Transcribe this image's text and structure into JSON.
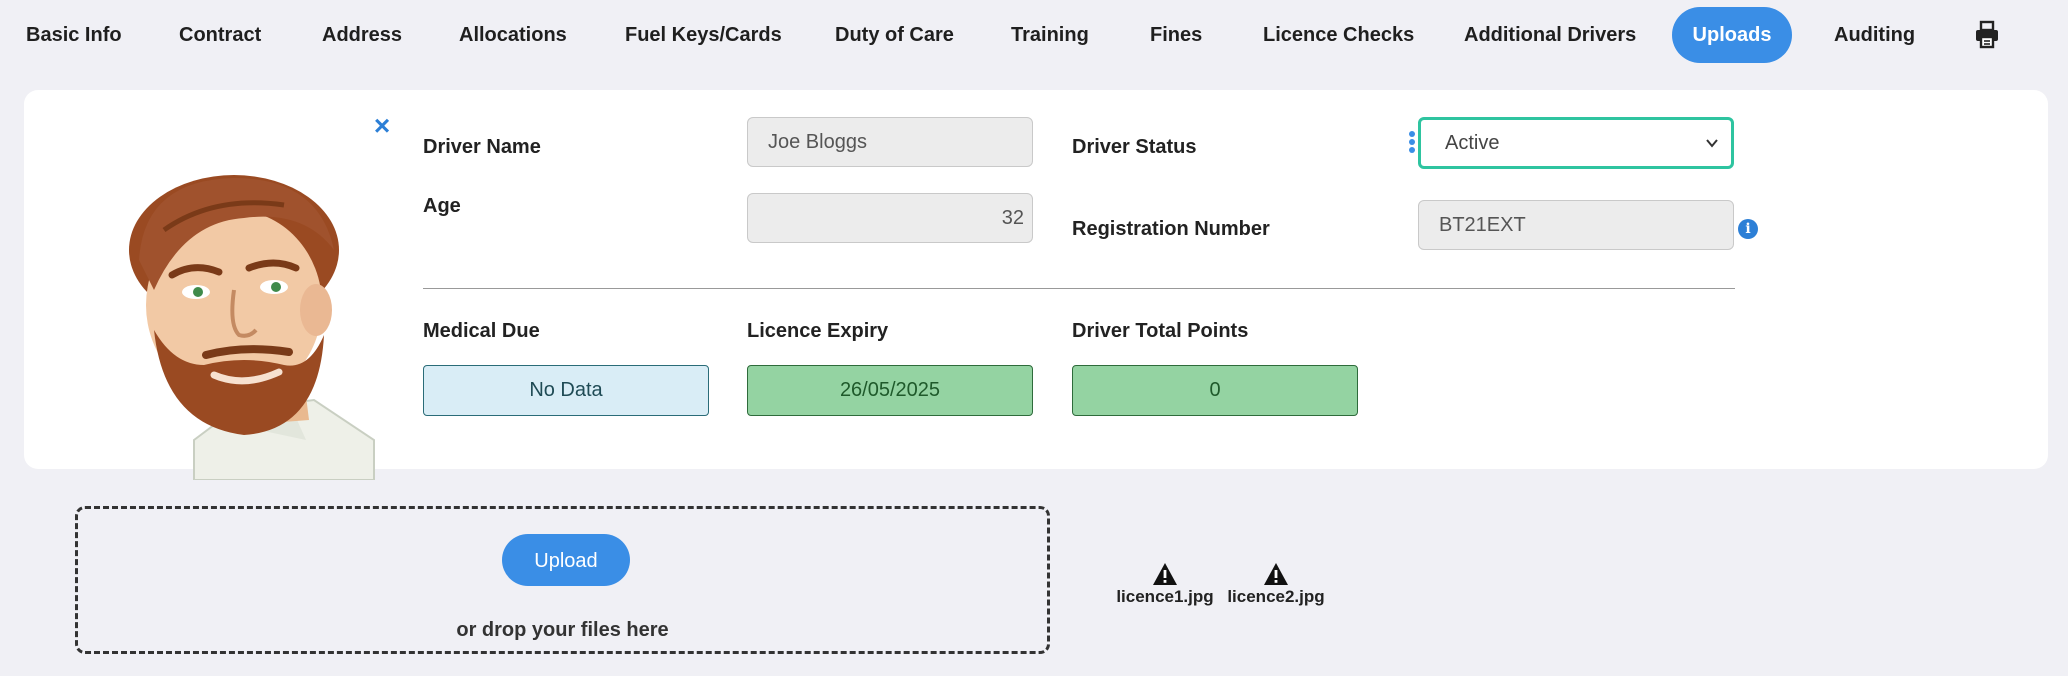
{
  "tabs": [
    {
      "label": "Basic Info"
    },
    {
      "label": "Contract"
    },
    {
      "label": "Address"
    },
    {
      "label": "Allocations"
    },
    {
      "label": "Fuel Keys/Cards"
    },
    {
      "label": "Duty of Care"
    },
    {
      "label": "Training"
    },
    {
      "label": "Fines"
    },
    {
      "label": "Licence Checks"
    },
    {
      "label": "Additional Drivers"
    },
    {
      "label": "Uploads",
      "active": true
    },
    {
      "label": "Auditing"
    }
  ],
  "driver": {
    "name_label": "Driver Name",
    "name_value": "Joe Bloggs",
    "age_label": "Age",
    "age_value": "32",
    "status_label": "Driver Status",
    "status_value": "Active",
    "registration_label": "Registration Number",
    "registration_value": "BT21EXT",
    "close_symbol": "×",
    "info_symbol": "i"
  },
  "stats": {
    "medical_label": "Medical Due",
    "medical_value": "No Data",
    "licence_label": "Licence Expiry",
    "licence_value": "26/05/2025",
    "points_label": "Driver Total Points",
    "points_value": "0"
  },
  "upload": {
    "button_label": "Upload",
    "drop_text": "or drop your files here"
  },
  "files": [
    {
      "name": "licence1.jpg"
    },
    {
      "name": "licence2.jpg"
    }
  ],
  "icons": {
    "print": "printer-icon",
    "warning": "warning-icon",
    "info": "info-icon",
    "close": "close-icon"
  },
  "colors": {
    "accent": "#3a8ee6",
    "select_border": "#2ec4a0",
    "stat_green": "#94d3a2",
    "stat_blue": "#d9edf6"
  }
}
